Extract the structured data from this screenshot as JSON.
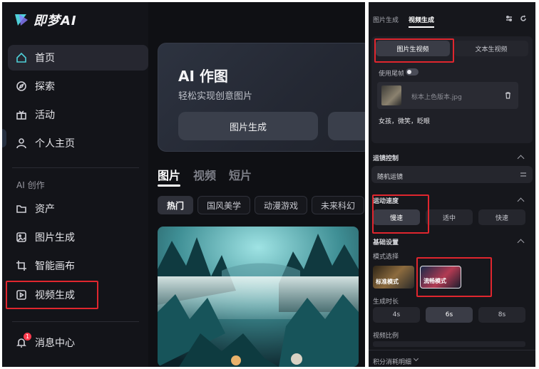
{
  "left": {
    "brand": "即梦AI",
    "nav": [
      {
        "label": "首页",
        "icon": "home-icon",
        "active": true
      },
      {
        "label": "探索",
        "icon": "compass-icon"
      },
      {
        "label": "活动",
        "icon": "gift-icon"
      },
      {
        "label": "个人主页",
        "icon": "user-icon"
      }
    ],
    "section_label": "AI 创作",
    "create_nav": [
      {
        "label": "资产",
        "icon": "folder-icon"
      },
      {
        "label": "图片生成",
        "icon": "image-gen-icon"
      },
      {
        "label": "智能画布",
        "icon": "canvas-crop-icon"
      },
      {
        "label": "视频生成",
        "icon": "video-gen-icon"
      }
    ],
    "messages": {
      "label": "消息中心",
      "badge": "1",
      "icon": "bell-icon"
    },
    "hero": {
      "title": "AI 作图",
      "subtitle": "轻松实现创意图片",
      "button": "图片生成"
    },
    "tabs": [
      "图片",
      "视频",
      "短片"
    ],
    "chips": [
      "热门",
      "国风美学",
      "动漫游戏",
      "未来科幻"
    ]
  },
  "right": {
    "tabs": [
      "图片生成",
      "视频生成"
    ],
    "mode_tabs": [
      "图片生视频",
      "文本生视频"
    ],
    "use_last_frame": "使用尾帧",
    "file_name": "标本上色版本.jpg",
    "prompt": "女孩，微笑，眨眼",
    "camera_control": {
      "label": "运镜控制",
      "value": "随机运镜"
    },
    "motion_speed": {
      "label": "运动速度",
      "options": [
        "慢速",
        "适中",
        "快速"
      ],
      "selected": "慢速"
    },
    "basic_settings": "基础设置",
    "model_select": {
      "label": "模式选择",
      "options": [
        "标准模式",
        "流畅模式"
      ],
      "selected": "流畅模式"
    },
    "duration": {
      "label": "生成时长",
      "options": [
        "4s",
        "6s",
        "8s"
      ],
      "selected": "6s"
    },
    "ratio_label": "视频比例",
    "credits": "积分消耗明细",
    "colors": {
      "highlight": "#e0262e",
      "accent": "#4fd0d8"
    }
  }
}
